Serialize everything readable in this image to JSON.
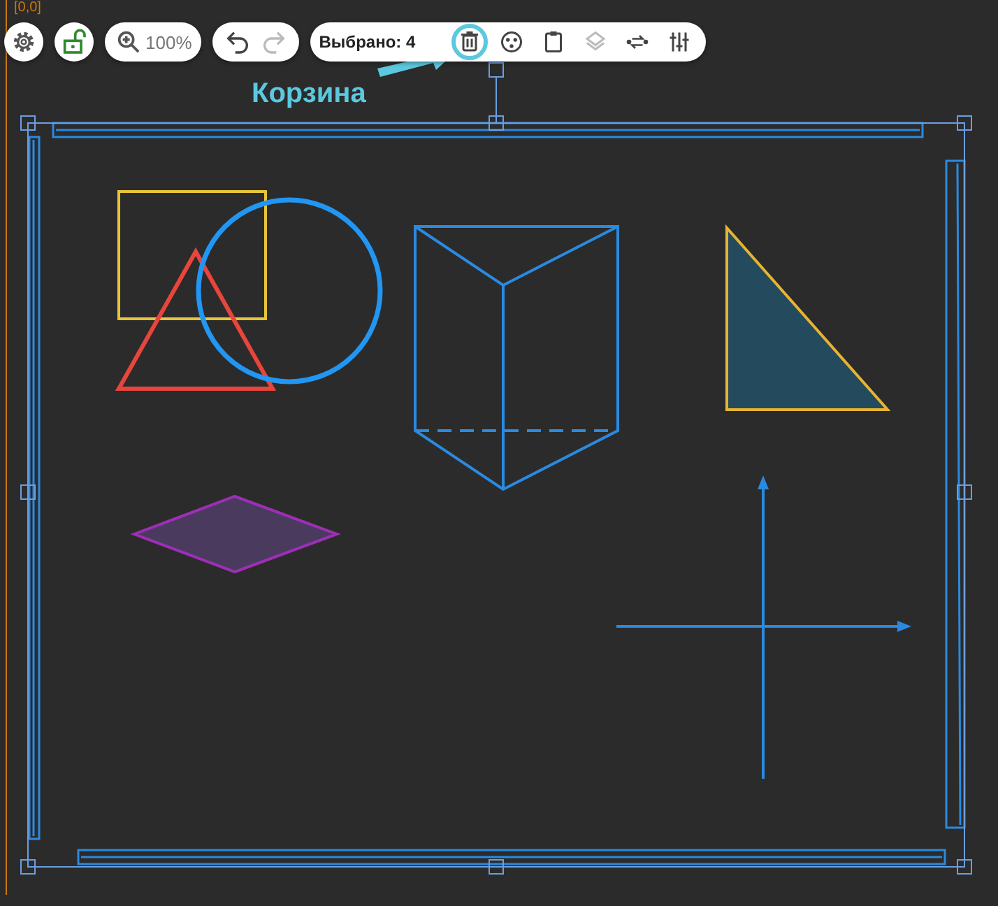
{
  "origin_label": "[0,0]",
  "toolbar": {
    "lock": {
      "locked": false
    },
    "zoom": "100%",
    "undo_enabled": true,
    "redo_enabled": false,
    "selected_label": "Выбрано: 4",
    "actions": [
      {
        "kind": "trash",
        "highlighted": true,
        "disabled": false
      },
      {
        "kind": "group",
        "highlighted": false,
        "disabled": false
      },
      {
        "kind": "clipboard",
        "highlighted": false,
        "disabled": false
      },
      {
        "kind": "layers",
        "highlighted": false,
        "disabled": true
      },
      {
        "kind": "connect",
        "highlighted": false,
        "disabled": false
      },
      {
        "kind": "adjust",
        "highlighted": false,
        "disabled": false
      }
    ]
  },
  "callout": {
    "label": "Корзина"
  },
  "shapes": [
    {
      "kind": "rectangle",
      "color": "#e8c43a"
    },
    {
      "kind": "triangle",
      "color": "#e8453c"
    },
    {
      "kind": "circle",
      "color": "#2196f3"
    },
    {
      "kind": "prism",
      "color": "#2a8ae0"
    },
    {
      "kind": "right-triangle",
      "color": "#e8b430"
    },
    {
      "kind": "rhombus",
      "color": "#9c2fb5"
    },
    {
      "kind": "axes",
      "color": "#2a8ae0"
    }
  ]
}
